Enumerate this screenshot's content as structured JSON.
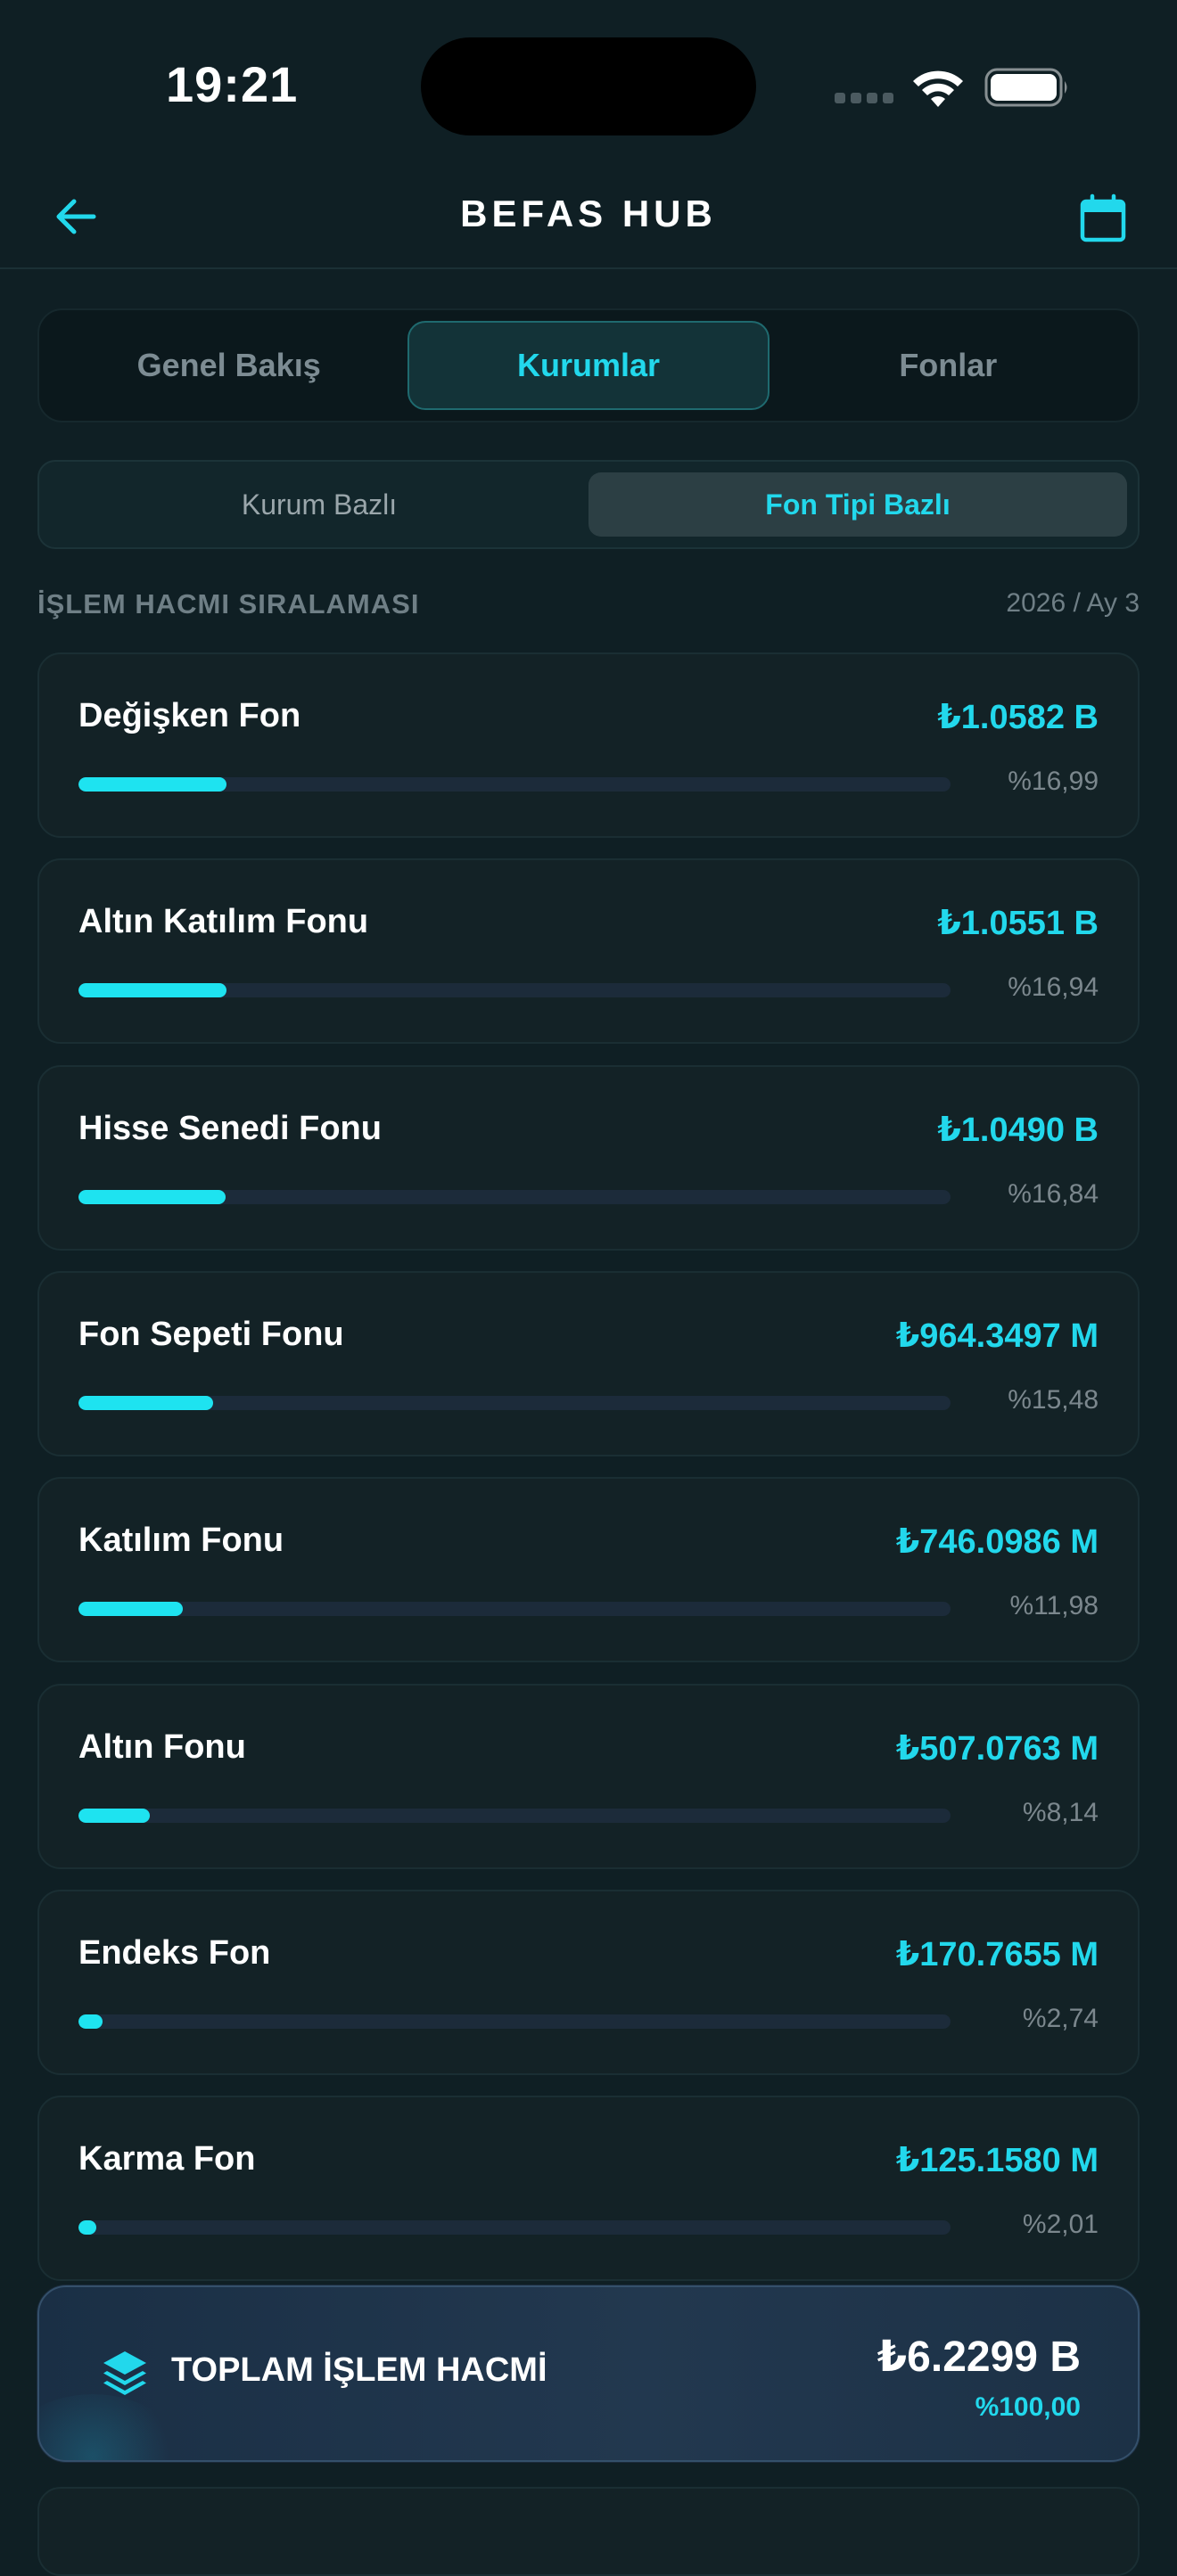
{
  "status_bar": {
    "time": "19:21"
  },
  "header": {
    "title": "BEFAS HUB",
    "back_icon": "arrow-left-icon",
    "calendar_icon": "calendar-icon"
  },
  "main_tabs": [
    {
      "label": "Genel Bakış",
      "active": false
    },
    {
      "label": "Kurumlar",
      "active": true
    },
    {
      "label": "Fonlar",
      "active": false
    }
  ],
  "sub_tabs": [
    {
      "label": "Kurum Bazlı",
      "active": false
    },
    {
      "label": "Fon Tipi Bazlı",
      "active": true
    }
  ],
  "section": {
    "title": "İŞLEM HACMI SIRALAMASI",
    "period": "2026 / Ay 3"
  },
  "ranking": [
    {
      "name": "Değişken Fon",
      "value": "₺1.0582 B",
      "percent": "%16,99",
      "share": 16.99
    },
    {
      "name": "Altın Katılım Fonu",
      "value": "₺1.0551 B",
      "percent": "%16,94",
      "share": 16.94
    },
    {
      "name": "Hisse Senedi Fonu",
      "value": "₺1.0490 B",
      "percent": "%16,84",
      "share": 16.84
    },
    {
      "name": "Fon Sepeti Fonu",
      "value": "₺964.3497 M",
      "percent": "%15,48",
      "share": 15.48
    },
    {
      "name": "Katılım Fonu",
      "value": "₺746.0986 M",
      "percent": "%11,98",
      "share": 11.98
    },
    {
      "name": "Altın Fonu",
      "value": "₺507.0763 M",
      "percent": "%8,14",
      "share": 8.14
    },
    {
      "name": "Endeks Fon",
      "value": "₺170.7655 M",
      "percent": "%2,74",
      "share": 2.74
    },
    {
      "name": "Karma Fon",
      "value": "₺125.1580 M",
      "percent": "%2,01",
      "share": 2.01
    }
  ],
  "total": {
    "label": "TOPLAM İŞLEM HACMİ",
    "value": "₺6.2299 B",
    "percent": "%100,00",
    "icon": "layers-icon"
  },
  "colors": {
    "background": "#0f1f24",
    "accent": "#22d8ec",
    "card": "#132226",
    "bar_track": "#1c2b3a"
  }
}
